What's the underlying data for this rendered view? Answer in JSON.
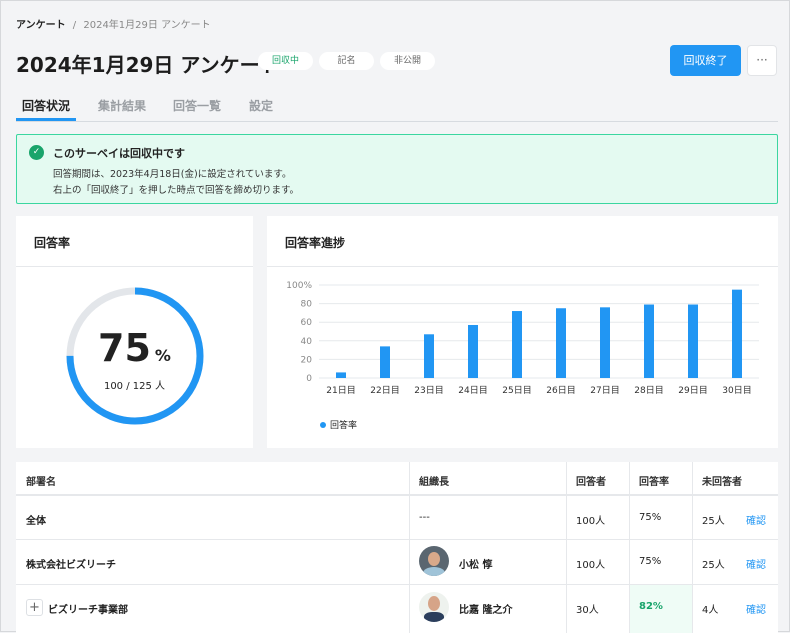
{
  "breadcrumb": {
    "root": "アンケート",
    "sep": "/",
    "current": "2024年1月29日 アンケート"
  },
  "header": {
    "title": "2024年1月29日 アンケート",
    "badges": [
      "回収中",
      "記名",
      "非公開"
    ],
    "end_button": "回収終了",
    "more_button": "···"
  },
  "tabs": [
    "回答状況",
    "集計結果",
    "回答一覧",
    "設定"
  ],
  "alert": {
    "title": "このサーベイは回収中です",
    "line1": "回答期間は、2023年4月18日(金)に設定されています。",
    "line2": "右上の「回収終了」を押した時点で回答を締め切ります。"
  },
  "rate_card": {
    "title": "回答率",
    "value": "75",
    "unit": "%",
    "detail": "100 / 125 人",
    "fraction": 0.75
  },
  "progress_card": {
    "title": "回答率進捗"
  },
  "chart_data": {
    "type": "bar",
    "title": "回答率進捗",
    "categories": [
      "21日目",
      "22日目",
      "23日目",
      "24日目",
      "25日目",
      "26日目",
      "27日目",
      "28日目",
      "29日目",
      "30日目"
    ],
    "series": [
      {
        "name": "回答率",
        "values": [
          6,
          34,
          47,
          57,
          72,
          75,
          76,
          79,
          79,
          95
        ]
      }
    ],
    "yticks": [
      "0",
      "20",
      "40",
      "60",
      "80",
      "100%"
    ],
    "ylim": [
      0,
      100
    ],
    "grid": true,
    "legend": "bottom-left",
    "color": "#2196f3"
  },
  "table": {
    "headers": [
      "部署名",
      "組織長",
      "回答者",
      "回答率",
      "未回答者"
    ],
    "rows": [
      {
        "dept": "全体",
        "leader": "---",
        "respondents": "100人",
        "rate": "75%",
        "unanswered": "25人",
        "action": "確認"
      },
      {
        "dept": "株式会社ビズリーチ",
        "leader": "小松 惇",
        "respondents": "100人",
        "rate": "75%",
        "unanswered": "25人",
        "action": "確認"
      },
      {
        "dept": "ビズリーチ事業部",
        "leader": "比嘉 隆之介",
        "respondents": "30人",
        "rate": "82%",
        "unanswered": "4人",
        "action": "確認",
        "expand": "+"
      }
    ]
  }
}
